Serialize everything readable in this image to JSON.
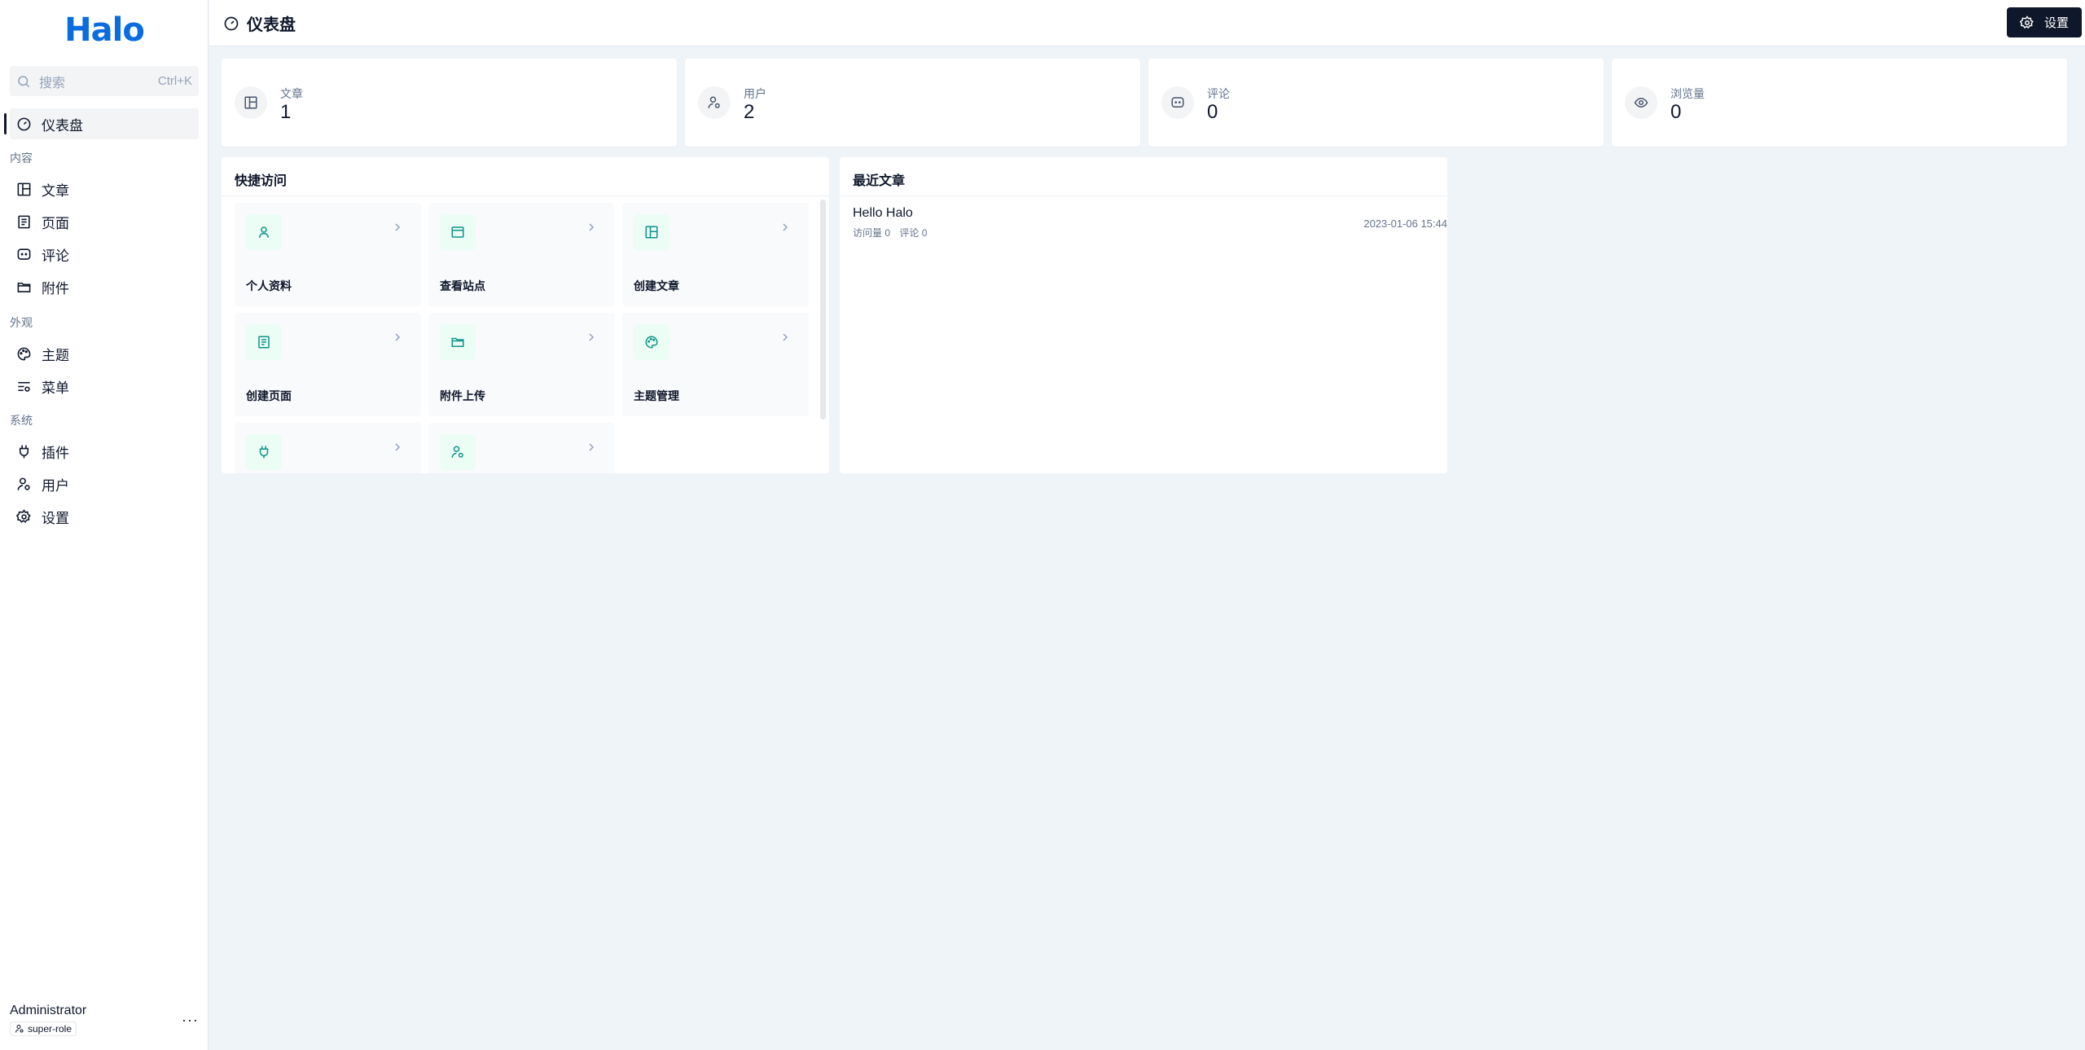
{
  "app": {
    "logo": "Halo"
  },
  "search": {
    "placeholder": "搜索",
    "shortcut": "Ctrl+K"
  },
  "sidebar": {
    "dashboard": "仪表盘",
    "groups": {
      "content": "内容",
      "appearance": "外观",
      "system": "系统"
    },
    "items": {
      "posts": "文章",
      "pages": "页面",
      "comments": "评论",
      "attachments": "附件",
      "themes": "主题",
      "menus": "菜单",
      "plugins": "插件",
      "users": "用户",
      "settings": "设置"
    }
  },
  "user": {
    "name": "Administrator",
    "role": "super-role",
    "more": "···"
  },
  "header": {
    "title": "仪表盘",
    "settings_label": "设置"
  },
  "stats": [
    {
      "label": "文章",
      "value": "1",
      "icon": "posts-icon"
    },
    {
      "label": "用户",
      "value": "2",
      "icon": "users-icon"
    },
    {
      "label": "评论",
      "value": "0",
      "icon": "comments-icon"
    },
    {
      "label": "浏览量",
      "value": "0",
      "icon": "views-icon"
    }
  ],
  "quick_access": {
    "title": "快捷访问",
    "items": [
      {
        "label": "个人资料",
        "icon": "user-icon"
      },
      {
        "label": "查看站点",
        "icon": "site-icon"
      },
      {
        "label": "创建文章",
        "icon": "post-icon"
      },
      {
        "label": "创建页面",
        "icon": "page-icon"
      },
      {
        "label": "附件上传",
        "icon": "folder-icon"
      },
      {
        "label": "主题管理",
        "icon": "palette-icon"
      },
      {
        "label": "",
        "icon": "plug-icon"
      },
      {
        "label": "",
        "icon": "user-gear-icon"
      }
    ]
  },
  "recent_posts": {
    "title": "最近文章",
    "items": [
      {
        "title": "Hello Halo",
        "visits": "访问量 0",
        "comments": "评论 0",
        "date": "2023-01-06 15:44"
      }
    ]
  },
  "colors": {
    "brand": "#0a6cdf",
    "primary": "#0f172a",
    "accent": "#0d9488",
    "background": "#eff4f9"
  }
}
